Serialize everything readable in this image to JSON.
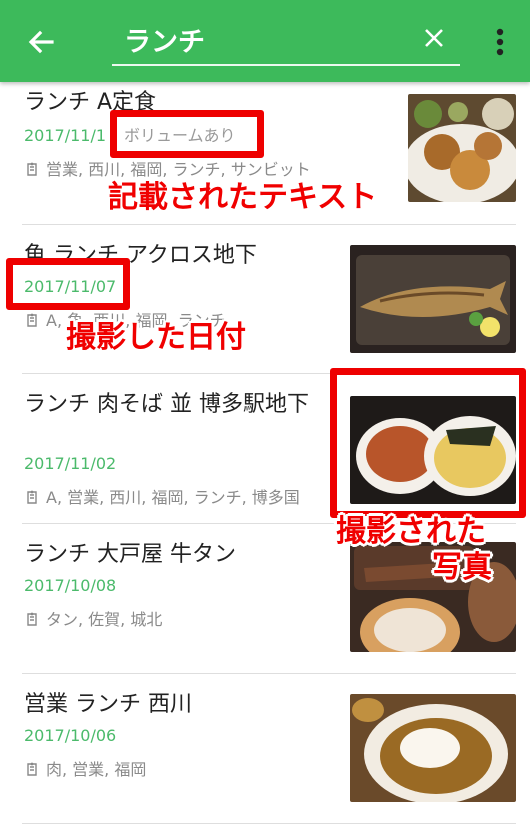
{
  "header": {
    "search_value": "ランチ",
    "back_icon": "arrow-left-icon",
    "clear_icon": "close-icon",
    "menu_icon": "more-vert-icon",
    "color": "#3dba5b"
  },
  "items": [
    {
      "title": "ランチ  A定食",
      "date": "2017/11/1",
      "note": "ボリュームあり",
      "tags": "営業, 西川, 福岡, ランチ, サンビット"
    },
    {
      "title": "魚  ランチ  アクロス地下",
      "date": "2017/11/07",
      "tags": "A, 魚, 西川, 福岡, ランチ"
    },
    {
      "title": "ランチ 肉そば 並 博多駅地下",
      "date": "2017/11/02",
      "tags": "A, 営業, 西川, 福岡, ランチ, 博多国"
    },
    {
      "title": "ランチ  大戸屋  牛タン",
      "date": "2017/10/08",
      "tags": "タン, 佐賀, 城北"
    },
    {
      "title": "営業 ランチ 西川",
      "date": "2017/10/06",
      "tags": "肉, 営業, 福岡"
    }
  ],
  "annotations": {
    "text_label": "記載されたテキスト",
    "date_label": "撮影した日付",
    "photo_label_line1": "撮影された",
    "photo_label_line2": "写真",
    "color": "#ee0000"
  }
}
